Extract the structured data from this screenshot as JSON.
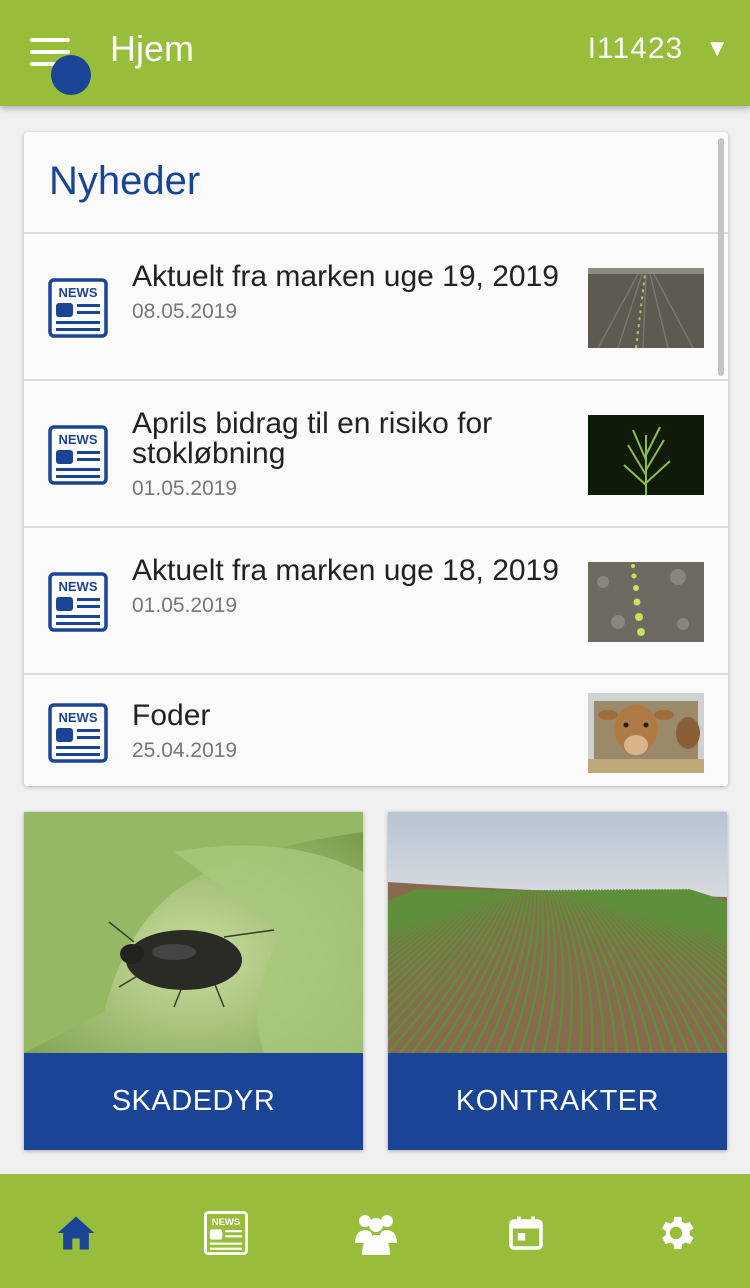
{
  "appbar": {
    "title": "Hjem",
    "account_id": "I11423",
    "caret": "▼",
    "menu_icon": "hamburger-menu-icon"
  },
  "news": {
    "heading": "Nyheder",
    "items": [
      {
        "title": "Aktuelt fra marken uge 19, 2019",
        "date": "08.05.2019",
        "icon": "news-icon",
        "thumb": "field-rows-thumbnail"
      },
      {
        "title": "Aprils bidrag til en risiko for stokløbning",
        "date": "01.05.2019",
        "icon": "news-icon",
        "thumb": "bolting-plant-thumbnail"
      },
      {
        "title": "Aktuelt fra marken uge 18, 2019",
        "date": "01.05.2019",
        "icon": "news-icon",
        "thumb": "seedlings-thumbnail"
      },
      {
        "title": "Foder",
        "date": "25.04.2019",
        "icon": "news-icon",
        "thumb": "cow-thumbnail"
      }
    ]
  },
  "tiles": [
    {
      "label": "SKADEDYR",
      "image": "aphid-on-leaf-image"
    },
    {
      "label": "KONTRAKTER",
      "image": "beet-field-image"
    }
  ],
  "bottom_nav": [
    {
      "name": "home",
      "icon": "home-icon"
    },
    {
      "name": "news",
      "icon": "news-icon"
    },
    {
      "name": "contacts",
      "icon": "people-icon"
    },
    {
      "name": "calendar",
      "icon": "calendar-icon"
    },
    {
      "name": "settings",
      "icon": "gear-icon"
    }
  ],
  "colors": {
    "green": "#97bd3b",
    "blue": "#1a4596",
    "white": "#ffffff"
  },
  "news_icon_text": "NEWS"
}
